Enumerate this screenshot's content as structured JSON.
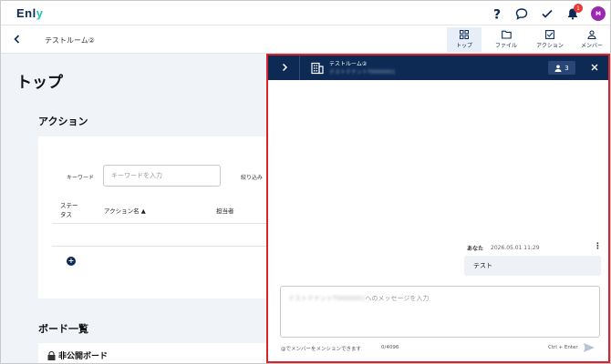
{
  "app": {
    "logo_main": "Enl",
    "logo_accent": "y"
  },
  "topbar": {
    "icons": [
      "help-icon",
      "chat-icon",
      "check-icon",
      "bell-icon"
    ],
    "notification_count": "1",
    "avatar_initial": "M",
    "avatar_color": "#9c27b0"
  },
  "subbar": {
    "room_title": "テストルーム②",
    "tabs": [
      {
        "label": "トップ",
        "icon": "grid-icon",
        "active": true
      },
      {
        "label": "ファイル",
        "icon": "folder-icon",
        "active": false
      },
      {
        "label": "アクション",
        "icon": "checkbox-icon",
        "active": false
      },
      {
        "label": "メンバー",
        "icon": "person-icon",
        "active": false
      }
    ]
  },
  "main": {
    "page_title": "トップ",
    "actions_section": "アクション",
    "keyword_label": "キーワード",
    "keyword_placeholder": "キーワードを入力",
    "filter_label": "絞り込み",
    "columns": {
      "status": "ステー\nタス",
      "action_name": "アクション名 ▲",
      "assignee": "担当者"
    },
    "board_section": "ボード一覧",
    "private_board": "非公開ボード"
  },
  "chat": {
    "room_title": "テストルーム②",
    "tenant_name": "テストテナントT0000001",
    "member_count": "3",
    "message": {
      "sender": "あなた",
      "time": "2026.05.01 11:29",
      "text": "テスト"
    },
    "composer_placeholder_prefix": "テストテナントT0000001",
    "composer_placeholder_suffix": "へのメッセージを入力",
    "mention_hint": "@でメンバーをメンションできます",
    "char_count": "0/4096",
    "send_shortcut": "Ctrl + Enter"
  },
  "colors": {
    "navy": "#0d2a55",
    "accent": "#1cc3b6",
    "highlight_border": "#d9232d",
    "badge": "#e53935"
  }
}
